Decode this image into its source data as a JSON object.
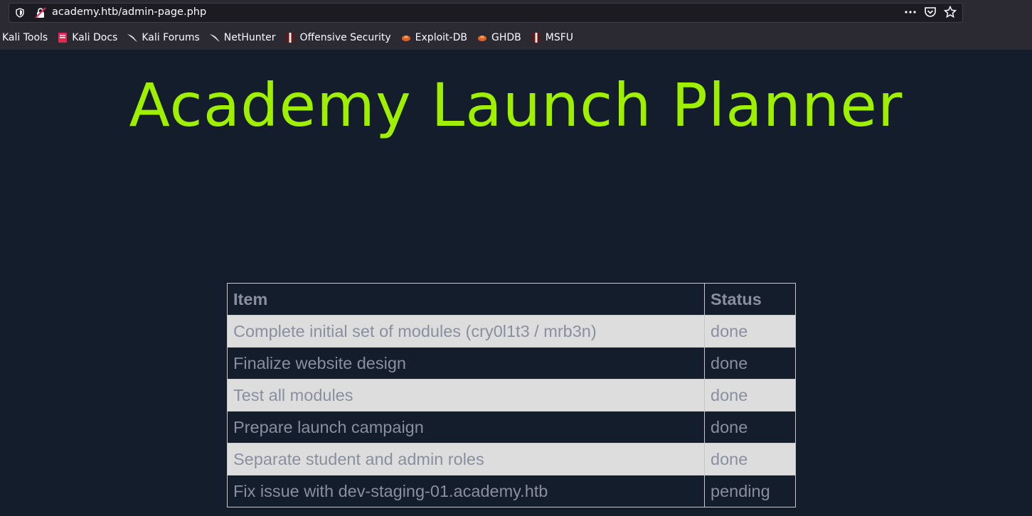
{
  "browser": {
    "url": "academy.htb/admin-page.php",
    "bookmarks": [
      {
        "label": "Kali Tools",
        "icon": "kali-tools-icon"
      },
      {
        "label": "Kali Docs",
        "icon": "kali-docs-icon"
      },
      {
        "label": "Kali Forums",
        "icon": "kali-dragon-icon"
      },
      {
        "label": "NetHunter",
        "icon": "kali-dragon-icon"
      },
      {
        "label": "Offensive Security",
        "icon": "offsec-icon"
      },
      {
        "label": "Exploit-DB",
        "icon": "exploitdb-icon"
      },
      {
        "label": "GHDB",
        "icon": "exploitdb-icon"
      },
      {
        "label": "MSFU",
        "icon": "offsec-icon"
      }
    ]
  },
  "page": {
    "title": "Academy Launch Planner",
    "table": {
      "headers": [
        "Item",
        "Status"
      ],
      "rows": [
        [
          "Complete initial set of modules (cry0l1t3 / mrb3n)",
          "done"
        ],
        [
          "Finalize website design",
          "done"
        ],
        [
          "Test all modules",
          "done"
        ],
        [
          "Prepare launch campaign",
          "done"
        ],
        [
          "Separate student and admin roles",
          "done"
        ],
        [
          "Fix issue with dev-staging-01.academy.htb",
          "pending"
        ]
      ]
    }
  },
  "colors": {
    "title": "#9fef00",
    "background": "#141d2b",
    "row_light": "#dddddd",
    "text": "#8a8fa0"
  }
}
